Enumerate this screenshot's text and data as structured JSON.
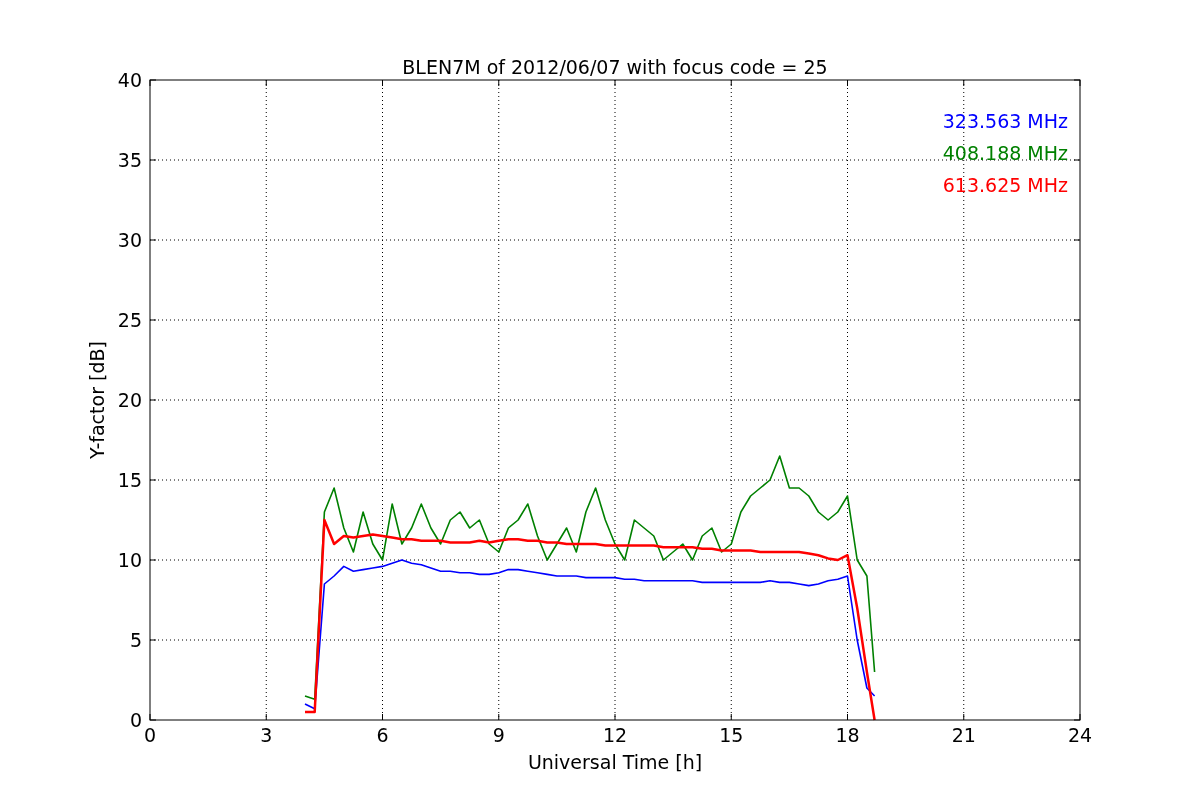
{
  "chart_data": {
    "type": "line",
    "title": "BLEN7M of 2012/06/07 with focus code = 25",
    "xlabel": "Universal Time [h]",
    "ylabel": "Y-factor [dB]",
    "grid": true,
    "xlim": [
      0,
      24
    ],
    "ylim": [
      0,
      40
    ],
    "xticks": [
      0,
      3,
      6,
      9,
      12,
      15,
      18,
      21,
      24
    ],
    "yticks": [
      0,
      5,
      10,
      15,
      20,
      25,
      30,
      35,
      40
    ],
    "x": [
      4,
      4.25,
      4.5,
      4.75,
      5,
      5.25,
      5.5,
      5.75,
      6,
      6.25,
      6.5,
      6.75,
      7,
      7.25,
      7.5,
      7.75,
      8,
      8.25,
      8.5,
      8.75,
      9,
      9.25,
      9.5,
      9.75,
      10,
      10.25,
      10.5,
      10.75,
      11,
      11.25,
      11.5,
      11.75,
      12,
      12.25,
      12.5,
      12.75,
      13,
      13.25,
      13.5,
      13.75,
      14,
      14.25,
      14.5,
      14.75,
      15,
      15.25,
      15.5,
      15.75,
      16,
      16.25,
      16.5,
      16.75,
      17,
      17.25,
      17.5,
      17.75,
      18,
      18.25,
      18.5,
      18.7
    ],
    "series": [
      {
        "name": "323.563 MHz",
        "color": "#0000ff",
        "values": [
          1.0,
          0.7,
          8.5,
          9.0,
          9.6,
          9.3,
          9.4,
          9.5,
          9.6,
          9.8,
          10.0,
          9.8,
          9.7,
          9.5,
          9.3,
          9.3,
          9.2,
          9.2,
          9.1,
          9.1,
          9.2,
          9.4,
          9.4,
          9.3,
          9.2,
          9.1,
          9.0,
          9.0,
          9.0,
          8.9,
          8.9,
          8.9,
          8.9,
          8.8,
          8.8,
          8.7,
          8.7,
          8.7,
          8.7,
          8.7,
          8.7,
          8.6,
          8.6,
          8.6,
          8.6,
          8.6,
          8.6,
          8.6,
          8.7,
          8.6,
          8.6,
          8.5,
          8.4,
          8.5,
          8.7,
          8.8,
          9.0,
          5.0,
          2.0,
          1.5
        ]
      },
      {
        "name": "408.188 MHz",
        "color": "#008000",
        "values": [
          1.5,
          1.3,
          13.0,
          14.5,
          12.0,
          10.5,
          13.0,
          11.0,
          10.0,
          13.5,
          11.0,
          12.0,
          13.5,
          12.0,
          11.0,
          12.5,
          13.0,
          12.0,
          12.5,
          11.0,
          10.5,
          12.0,
          12.5,
          13.5,
          11.5,
          10.0,
          11.0,
          12.0,
          10.5,
          13.0,
          14.5,
          12.5,
          11.0,
          10.0,
          12.5,
          12.0,
          11.5,
          10.0,
          10.5,
          11.0,
          10.0,
          11.5,
          12.0,
          10.5,
          11.0,
          13.0,
          14.0,
          14.5,
          15.0,
          16.5,
          14.5,
          14.5,
          14.0,
          13.0,
          12.5,
          13.0,
          14.0,
          10.0,
          9.0,
          3.0
        ]
      },
      {
        "name": "613.625 MHz",
        "color": "#ff0000",
        "values": [
          0.5,
          0.5,
          12.5,
          11.0,
          11.5,
          11.4,
          11.5,
          11.6,
          11.5,
          11.4,
          11.3,
          11.3,
          11.2,
          11.2,
          11.2,
          11.1,
          11.1,
          11.1,
          11.2,
          11.1,
          11.2,
          11.3,
          11.3,
          11.2,
          11.2,
          11.1,
          11.1,
          11.0,
          11.0,
          11.0,
          11.0,
          10.9,
          10.9,
          10.9,
          10.9,
          10.9,
          10.9,
          10.8,
          10.8,
          10.8,
          10.8,
          10.7,
          10.7,
          10.6,
          10.6,
          10.6,
          10.6,
          10.5,
          10.5,
          10.5,
          10.5,
          10.5,
          10.4,
          10.3,
          10.1,
          10.0,
          10.3,
          7.0,
          3.0,
          0.0
        ]
      }
    ]
  }
}
